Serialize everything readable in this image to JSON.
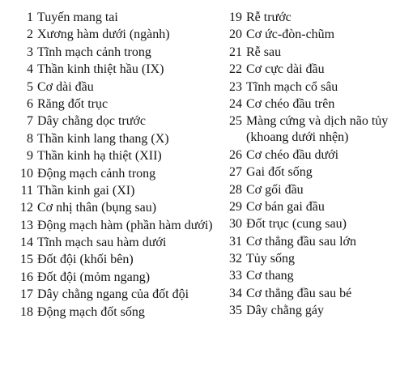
{
  "legend": {
    "left_column": [
      {
        "num": "1",
        "label": "Tuyến mang tai"
      },
      {
        "num": "2",
        "label": "Xương hàm dưới (ngành)"
      },
      {
        "num": "3",
        "label": "Tĩnh mạch cảnh trong"
      },
      {
        "num": "4",
        "label": "Thần kinh thiệt hầu (IX)"
      },
      {
        "num": "5",
        "label": "Cơ dài đầu"
      },
      {
        "num": "6",
        "label": "Răng đốt trục"
      },
      {
        "num": "7",
        "label": "Dây chằng dọc trước"
      },
      {
        "num": "8",
        "label": "Thần kinh lang thang (X)"
      },
      {
        "num": "9",
        "label": "Thần kinh hạ thiệt (XII)"
      },
      {
        "num": "10",
        "label": "Động mạch cảnh trong"
      },
      {
        "num": "11",
        "label": "Thần kinh gai (XI)"
      },
      {
        "num": "12",
        "label": "Cơ nhị thân (bụng sau)"
      },
      {
        "num": "13",
        "label": "Động mạch hàm (phần hàm dưới)"
      },
      {
        "num": "14",
        "label": "Tĩnh mạch sau hàm dưới"
      },
      {
        "num": "15",
        "label": "Đốt đội (khối bên)"
      },
      {
        "num": "16",
        "label": "Đốt đội (mỏm ngang)"
      },
      {
        "num": "17",
        "label": "Dây chằng ngang của đốt đội"
      },
      {
        "num": "18",
        "label": "Động mạch đốt sống"
      }
    ],
    "right_column": [
      {
        "num": "19",
        "label": "Rễ trước"
      },
      {
        "num": "20",
        "label": "Cơ ức-đòn-chũm"
      },
      {
        "num": "21",
        "label": "Rễ sau"
      },
      {
        "num": "22",
        "label": "Cơ cực dài đầu"
      },
      {
        "num": "23",
        "label": "Tĩnh mạch cổ sâu"
      },
      {
        "num": "24",
        "label": "Cơ chéo đầu trên"
      },
      {
        "num": "25",
        "label": "Màng cứng và dịch não tủy (khoang dưới nhện)"
      },
      {
        "num": "26",
        "label": "Cơ chéo đầu dưới"
      },
      {
        "num": "27",
        "label": "Gai đốt sống"
      },
      {
        "num": "28",
        "label": "Cơ gối đầu"
      },
      {
        "num": "29",
        "label": "Cơ bán gai đầu"
      },
      {
        "num": "30",
        "label": "Đốt trục (cung sau)"
      },
      {
        "num": "31",
        "label": "Cơ thẳng đầu sau lớn"
      },
      {
        "num": "32",
        "label": "Tủy sống"
      },
      {
        "num": "33",
        "label": "Cơ thang"
      },
      {
        "num": "34",
        "label": "Cơ thẳng đầu sau bé"
      },
      {
        "num": "35",
        "label": "Dây chằng gáy"
      }
    ]
  }
}
